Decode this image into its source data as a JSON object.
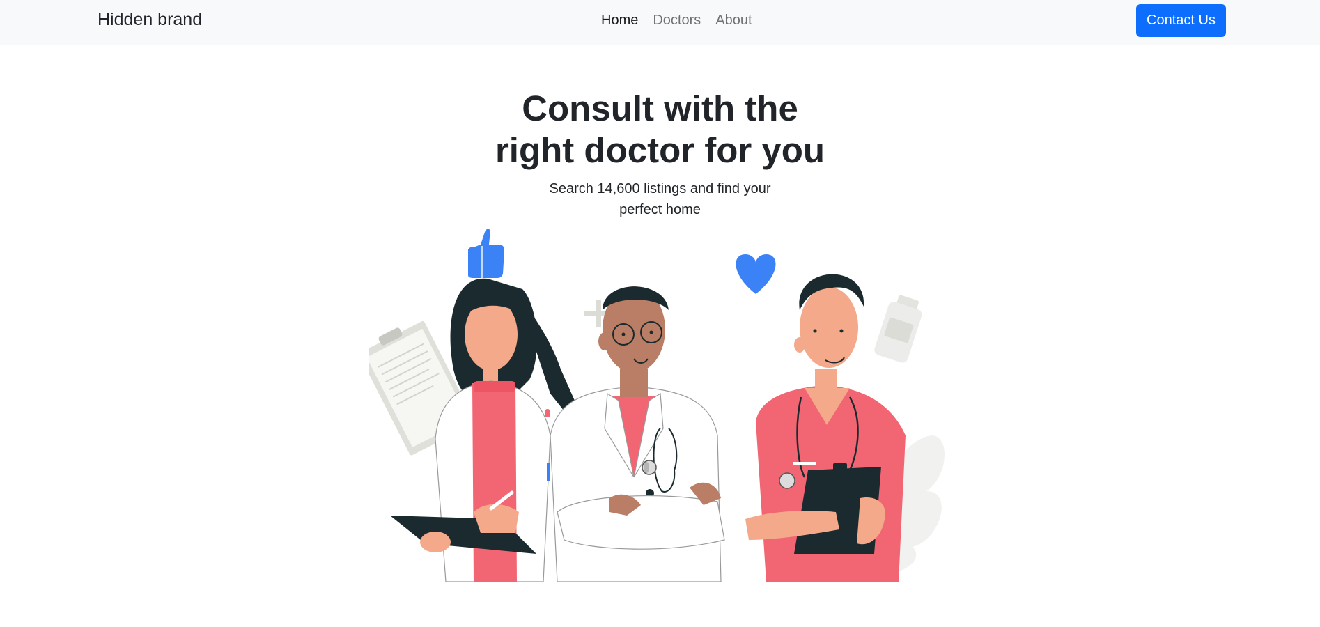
{
  "navbar": {
    "brand": "Hidden brand",
    "links": [
      {
        "label": "Home",
        "active": true
      },
      {
        "label": "Doctors",
        "active": false
      },
      {
        "label": "About",
        "active": false
      }
    ],
    "contact_label": "Contact Us"
  },
  "hero": {
    "title_line1": "Consult with the",
    "title_line2": "right doctor for you",
    "subtitle_line1": "Search 14,600 listings and find your",
    "subtitle_line2": "perfect home"
  },
  "illustration": {
    "icons": [
      "thumbs-up-icon",
      "heart-icon",
      "plus-icon",
      "clipboard-icon",
      "pill-bottle-icon",
      "plant-leaf-icon"
    ],
    "accent_color": "#3b82f6",
    "scrub_color": "#f26673"
  },
  "colors": {
    "accent": "#0d6efd",
    "navbar_bg": "#f8f9fa",
    "text": "#212529"
  }
}
